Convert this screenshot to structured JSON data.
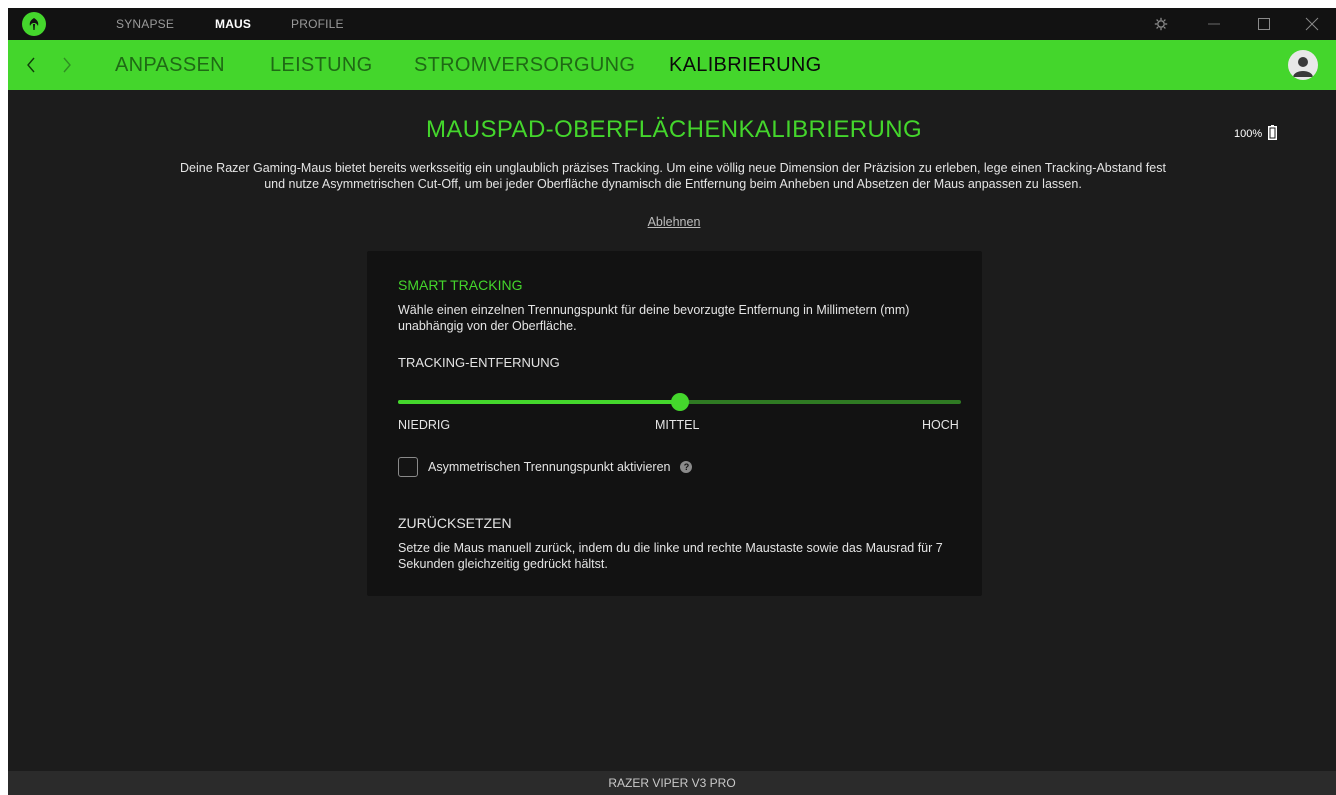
{
  "app": {
    "top_tabs": [
      {
        "label": "SYNAPSE",
        "active": false
      },
      {
        "label": "MAUS",
        "active": true
      },
      {
        "label": "PROFILE",
        "active": false
      }
    ],
    "window_controls": [
      "gear-icon",
      "minimize-icon",
      "maximize-icon",
      "close-icon"
    ]
  },
  "nav": {
    "tabs": [
      {
        "label": "ANPASSEN",
        "active": false
      },
      {
        "label": "LEISTUNG",
        "active": false
      },
      {
        "label": "STROMVERSORGUNG",
        "active": false
      },
      {
        "label": "KALIBRIERUNG",
        "active": true
      }
    ]
  },
  "main": {
    "title": "MAUSPAD-OBERFLÄCHENKALIBRIERUNG",
    "battery": "100%",
    "intro": "Deine Razer Gaming-Maus bietet bereits werksseitig ein unglaublich präzises Tracking. Um eine völlig neue Dimension der Präzision zu erleben, lege einen Tracking-Abstand fest und nutze Asymmetrischen Cut-Off, um bei jeder Oberfläche dynamisch die Entfernung beim Anheben und Absetzen der Maus anpassen zu lassen.",
    "decline": "Ablehnen"
  },
  "card": {
    "smart_tracking": {
      "heading": "SMART TRACKING",
      "description": "Wähle einen einzelnen Trennungspunkt für deine bevorzugte Entfernung in Millimetern (mm) unabhängig von der Oberfläche."
    },
    "tracking_distance": {
      "label": "TRACKING-ENTFERNUNG",
      "value": 0.5,
      "low": "NIEDRIG",
      "mid": "MITTEL",
      "high": "HOCH"
    },
    "asymmetric": {
      "label": "Asymmetrischen Trennungspunkt aktivieren",
      "checked": false
    },
    "reset": {
      "heading": "ZURÜCKSETZEN",
      "description": "Setze die Maus manuell zurück, indem du die linke und rechte Maustaste sowie das Mausrad für 7 Sekunden gleichzeitig gedrückt hältst."
    }
  },
  "footer": {
    "device": "RAZER VIPER V3 PRO"
  },
  "colors": {
    "accent": "#44d62c",
    "background": "#1c1c1c",
    "card": "#121212"
  }
}
